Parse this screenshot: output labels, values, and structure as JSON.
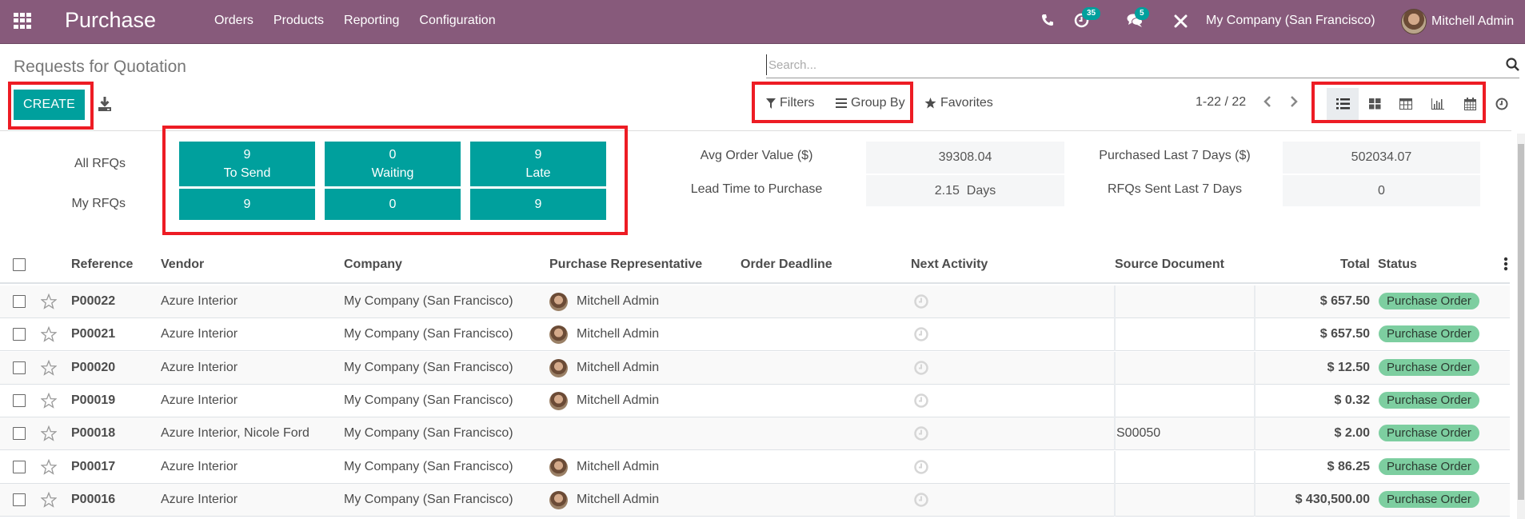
{
  "navbar": {
    "app_name": "Purchase",
    "menu": [
      "Orders",
      "Products",
      "Reporting",
      "Configuration"
    ],
    "activity_count": "35",
    "messages_count": "5",
    "company": "My Company (San Francisco)",
    "user": "Mitchell Admin",
    "icons": [
      "apps-icon",
      "phone-icon",
      "activity-clock-icon",
      "chat-icon",
      "tools-icon"
    ],
    "bg_color": "#875A7B",
    "badge_color": "#00A09D"
  },
  "control_panel": {
    "title": "Requests for Quotation",
    "create_label": "CREATE",
    "search_placeholder": "Search...",
    "filters_label": "Filters",
    "group_by_label": "Group By",
    "favorites_label": "Favorites",
    "pager": "1-22 / 22",
    "views": [
      "list",
      "kanban",
      "pivot",
      "graph",
      "calendar",
      "activity"
    ],
    "active_view": "list"
  },
  "dashboard": {
    "row_labels": [
      "All RFQs",
      "My RFQs"
    ],
    "tiles": [
      {
        "all": "9",
        "label": "To Send",
        "mine": "9"
      },
      {
        "all": "0",
        "label": "Waiting",
        "mine": "0"
      },
      {
        "all": "9",
        "label": "Late",
        "mine": "9"
      }
    ],
    "stats": [
      {
        "label": "Avg Order Value ($)",
        "value": "39308.04"
      },
      {
        "label": "Purchased Last 7 Days ($)",
        "value": "502034.07"
      },
      {
        "label": "Lead Time to Purchase",
        "value": "2.15  Days"
      },
      {
        "label": "RFQs Sent Last 7 Days",
        "value": "0"
      }
    ],
    "tile_color": "#00A09D"
  },
  "table": {
    "columns": [
      "Reference",
      "Vendor",
      "Company",
      "Purchase Representative",
      "Order Deadline",
      "Next Activity",
      "Source Document",
      "Total",
      "Status"
    ],
    "rows": [
      {
        "reference": "P00022",
        "vendor": "Azure Interior",
        "company": "My Company (San Francisco)",
        "rep": "Mitchell Admin",
        "deadline": "",
        "source": "",
        "total": "$ 657.50",
        "status": "Purchase Order"
      },
      {
        "reference": "P00021",
        "vendor": "Azure Interior",
        "company": "My Company (San Francisco)",
        "rep": "Mitchell Admin",
        "deadline": "",
        "source": "",
        "total": "$ 657.50",
        "status": "Purchase Order"
      },
      {
        "reference": "P00020",
        "vendor": "Azure Interior",
        "company": "My Company (San Francisco)",
        "rep": "Mitchell Admin",
        "deadline": "",
        "source": "",
        "total": "$ 12.50",
        "status": "Purchase Order"
      },
      {
        "reference": "P00019",
        "vendor": "Azure Interior",
        "company": "My Company (San Francisco)",
        "rep": "Mitchell Admin",
        "deadline": "",
        "source": "",
        "total": "$ 0.32",
        "status": "Purchase Order"
      },
      {
        "reference": "P00018",
        "vendor": "Azure Interior, Nicole Ford",
        "company": "My Company (San Francisco)",
        "rep": "",
        "deadline": "",
        "source": "S00050",
        "total": "$ 2.00",
        "status": "Purchase Order"
      },
      {
        "reference": "P00017",
        "vendor": "Azure Interior",
        "company": "My Company (San Francisco)",
        "rep": "Mitchell Admin",
        "deadline": "",
        "source": "",
        "total": "$ 86.25",
        "status": "Purchase Order"
      },
      {
        "reference": "P00016",
        "vendor": "Azure Interior",
        "company": "My Company (San Francisco)",
        "rep": "Mitchell Admin",
        "deadline": "",
        "source": "",
        "total": "$ 430,500.00",
        "status": "Purchase Order"
      }
    ],
    "status_color": "#7dcea0"
  }
}
